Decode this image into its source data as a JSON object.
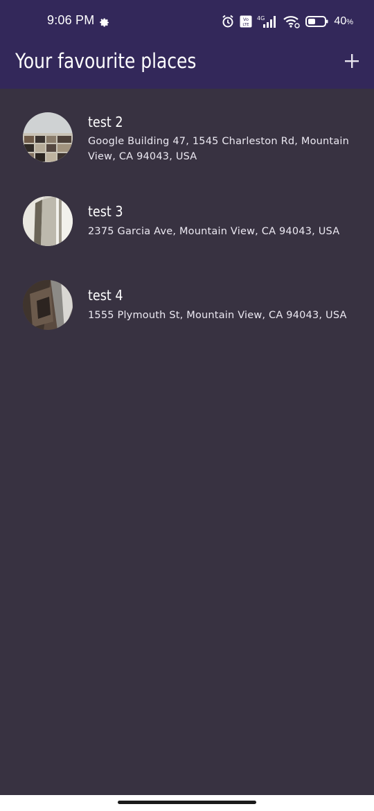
{
  "status_bar": {
    "time": "9:06 PM",
    "battery_percent": "40",
    "battery_suffix": "%",
    "network": "4G",
    "volte": "Vo LTE",
    "colors": {
      "background": "#33285a"
    }
  },
  "app_bar": {
    "title": "Your favourite places",
    "add_icon": "plus-icon",
    "colors": {
      "background": "#33285a"
    }
  },
  "places": [
    {
      "title": "test 2",
      "address": "Google Building 47, 1545 Charleston Rd, Mountain View, CA 94043, USA"
    },
    {
      "title": "test 3",
      "address": "2375 Garcia Ave, Mountain View, CA 94043, USA"
    },
    {
      "title": "test 4",
      "address": "1555 Plymouth St, Mountain View, CA 94043, USA"
    }
  ],
  "colors": {
    "page_background": "#383241",
    "text": "#ffffff"
  }
}
